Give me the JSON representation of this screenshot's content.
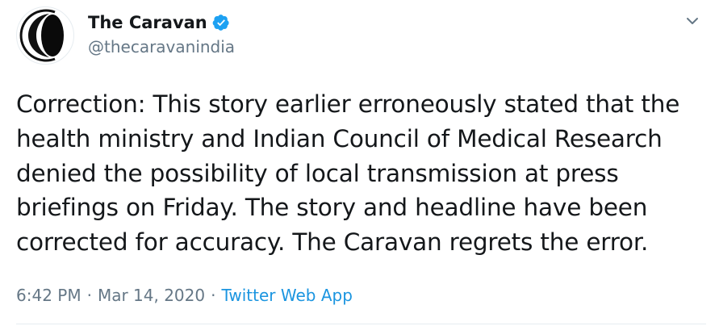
{
  "tweet": {
    "author": {
      "display_name": "The Caravan",
      "handle": "@thecaravanindia",
      "verified": true
    },
    "text_lines": [
      "Correction: This story earlier erroneously stated that the",
      "health ministry and Indian Council of Medical Research",
      "denied the possibility of local transmission at press",
      "briefings on Friday. The story and headline have been",
      "corrected for accuracy. The Caravan regrets the error."
    ],
    "time": "6:42 PM",
    "date": "Mar 14, 2020",
    "source": "Twitter Web App",
    "separator": "·"
  },
  "icons": {
    "verified": "verified-badge-icon",
    "menu": "chevron-down-icon",
    "avatar": "caravan-logo-icon"
  },
  "colors": {
    "text": "#14171a",
    "secondary": "#657786",
    "link": "#1b95e0",
    "verified": "#1da1f2"
  }
}
